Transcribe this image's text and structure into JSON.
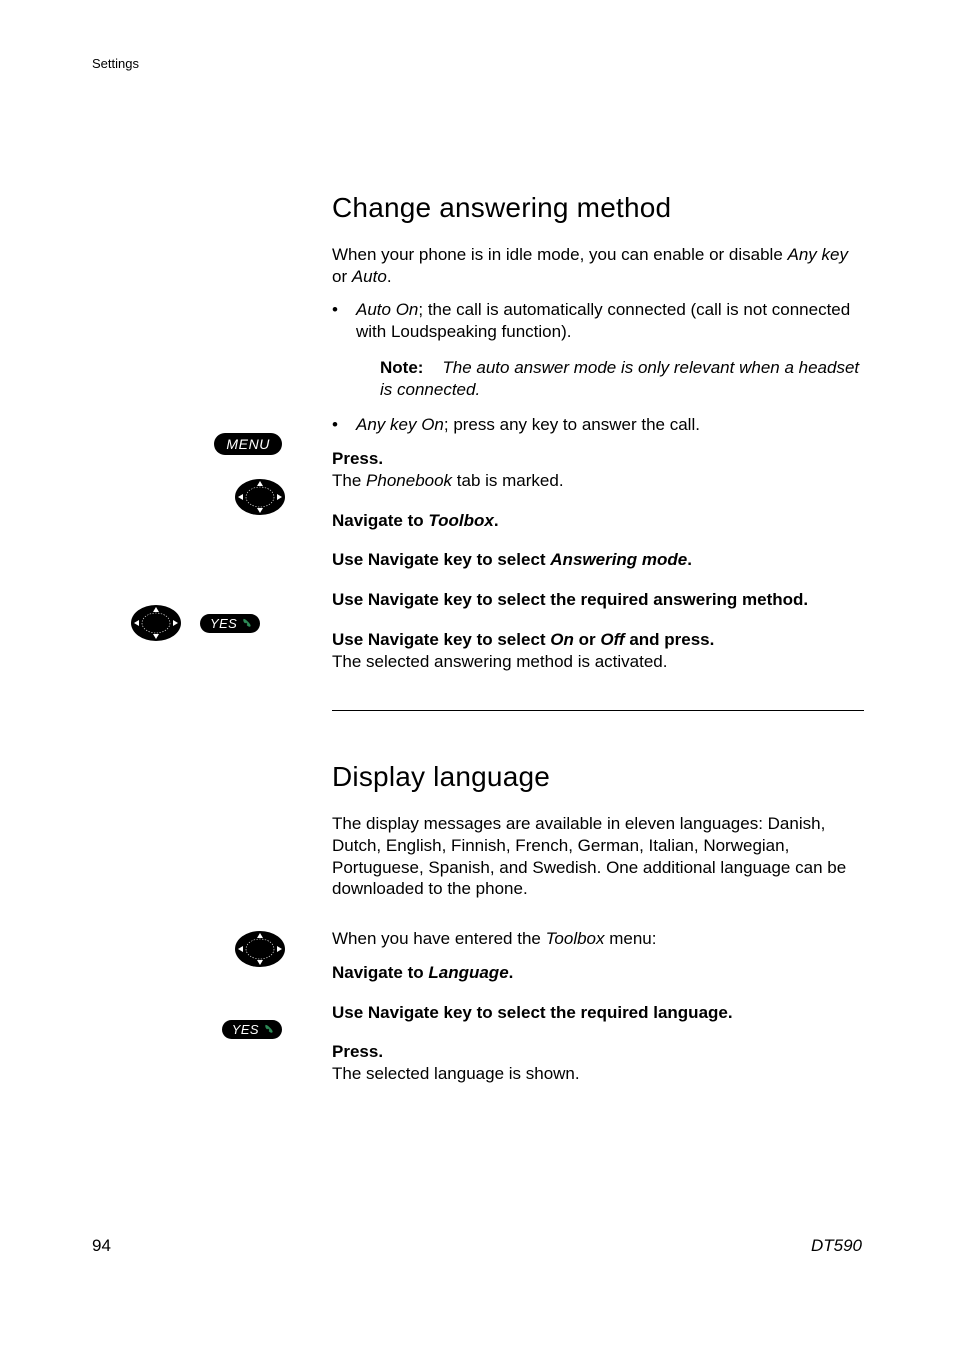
{
  "header": {
    "section": "Settings"
  },
  "section1": {
    "heading": "Change answering method",
    "intro_pre": "When your phone is in idle mode, you can enable or disable ",
    "intro_em1": "Any key",
    "intro_mid": " or ",
    "intro_em2": "Auto",
    "intro_end": ".",
    "bullet1_em": "Auto On",
    "bullet1_txt": "; the call is automatically connected (call is not connected with Loudspeaking function).",
    "note_label": "Note:",
    "note_text": "The auto answer mode is only relevant when a headset is connected.",
    "bullet2_em": "Any key On",
    "bullet2_txt": "; press any key to answer the call.",
    "step1_bold": "Press.",
    "step1_txt_pre": "The ",
    "step1_txt_em": "Phonebook",
    "step1_txt_post": " tab is marked.",
    "step2_bold_pre": "Navigate to ",
    "step2_bold_em": "Toolbox",
    "step2_bold_post": ".",
    "step3_bold_pre": "Use Navigate key to select ",
    "step3_bold_em": "Answering mode",
    "step3_bold_post": ".",
    "step4_bold": "Use Navigate key to select the required answering method.",
    "step5_bold_pre": "Use Navigate key to select ",
    "step5_bold_em1": "On",
    "step5_bold_mid": " or ",
    "step5_bold_em2": "Off",
    "step5_bold_post": " and press.",
    "step5_txt": "The selected answering method is activated."
  },
  "section2": {
    "heading": "Display language",
    "intro": "The display messages are available in eleven languages: Danish, Dutch, English, Finnish, French, German, Italian, Norwegian, Portuguese, Spanish, and Swedish. One additional language can be downloaded to the phone.",
    "pre_pre": "When you have entered the ",
    "pre_em": "Toolbox",
    "pre_post": " menu:",
    "step1_bold_pre": "Navigate to ",
    "step1_bold_em": "Language",
    "step1_bold_post": ".",
    "step2_bold": "Use Navigate key to select the required language.",
    "step3_bold": "Press.",
    "step3_txt": "The selected language is shown."
  },
  "icons": {
    "menu_label": "MENU",
    "yes_label": "YES"
  },
  "footer": {
    "page": "94",
    "model": "DT590"
  }
}
